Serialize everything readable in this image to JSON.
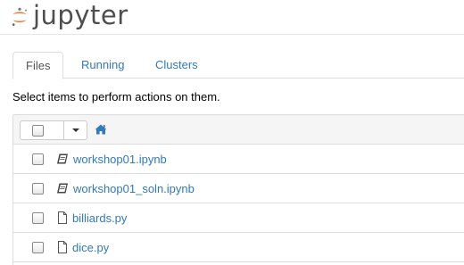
{
  "app": {
    "logo_text": "jupyter",
    "brand_color": "#f37626",
    "link_color": "#337ab7"
  },
  "tabs": [
    {
      "label": "Files",
      "active": true
    },
    {
      "label": "Running",
      "active": false
    },
    {
      "label": "Clusters",
      "active": false
    }
  ],
  "instructions": "Select items to perform actions on them.",
  "toolbar": {
    "select_all_checked": false,
    "dropdown_icon": "caret-down-icon",
    "home_icon": "home-icon"
  },
  "files": [
    {
      "name": "workshop01.ipynb",
      "icon": "notebook-icon",
      "checked": false
    },
    {
      "name": "workshop01_soln.ipynb",
      "icon": "notebook-icon",
      "checked": false
    },
    {
      "name": "billiards.py",
      "icon": "file-icon",
      "checked": false
    },
    {
      "name": "dice.py",
      "icon": "file-icon",
      "checked": false
    }
  ]
}
